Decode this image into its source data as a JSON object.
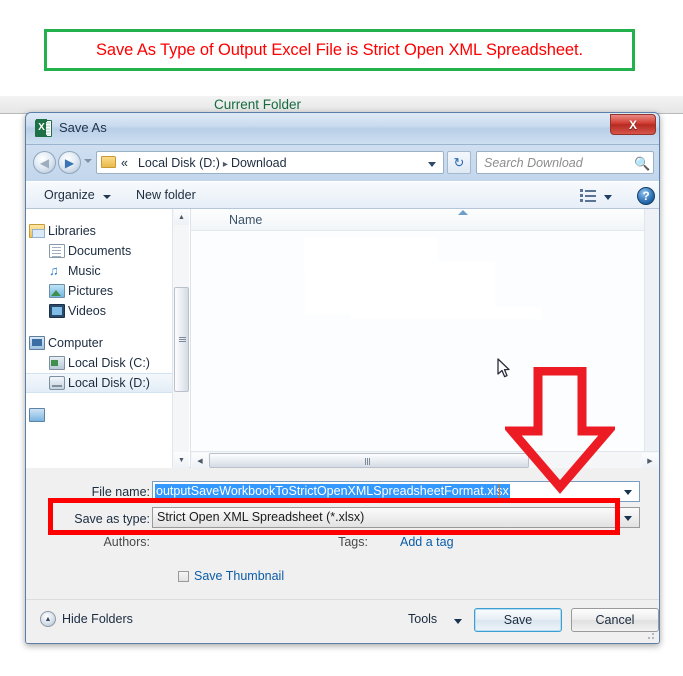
{
  "caption": {
    "text": "Save As Type of Output Excel File is Strict Open XML Spreadsheet.",
    "text_color": "#ff0000",
    "border_color": "#22b14c"
  },
  "background": {
    "label": "Current Folder",
    "label_color": "#156b3f"
  },
  "dialog": {
    "title": "Save As",
    "app_icon": "excel-icon",
    "close_label": "X",
    "address": {
      "back_icon": "back-arrow-icon",
      "forward_icon": "forward-arrow-icon",
      "recent_icon": "recent-pages-chevron-icon",
      "folder_icon": "folder-icon",
      "breadcrumb_prefix": "«",
      "breadcrumb": [
        "Local Disk (D:)",
        "Download"
      ],
      "breadcrumb_separator": "▸",
      "dropdown_icon": "chevron-down-icon",
      "refresh_icon": "↻",
      "search_placeholder": "Search Download",
      "search_icon": "search-icon"
    },
    "commandbar": {
      "organize": "Organize",
      "new_folder": "New folder",
      "view_icon": "view-layout-icon",
      "help_icon": "help-icon",
      "help_label": "?"
    },
    "navigation": {
      "groups": [
        {
          "label": "Libraries",
          "icon": "libraries-icon",
          "children": [
            {
              "label": "Documents",
              "icon": "documents-icon"
            },
            {
              "label": "Music",
              "icon": "music-icon"
            },
            {
              "label": "Pictures",
              "icon": "pictures-icon"
            },
            {
              "label": "Videos",
              "icon": "videos-icon"
            }
          ]
        },
        {
          "label": "Computer",
          "icon": "computer-icon",
          "children": [
            {
              "label": "Local Disk (C:)",
              "icon": "hard-disk-icon"
            },
            {
              "label": "Local Disk (D:)",
              "icon": "hard-disk-icon",
              "selected": true
            }
          ]
        }
      ]
    },
    "filelist": {
      "column_header": "Name",
      "sort_icon": "sort-ascending-icon",
      "items": []
    },
    "form": {
      "filename_label": "File name:",
      "filename_value": "outputSaveWorkbookToStrictOpenXMLSpreadsheetFormat.xlsx",
      "savetype_label": "Save as type:",
      "savetype_value": "Strict Open XML Spreadsheet (*.xlsx)",
      "authors_label": "Authors:",
      "authors_value": "",
      "tags_label": "Tags:",
      "tags_link": "Add a tag",
      "thumbnail_label": "Save Thumbnail",
      "thumbnail_checked": false
    },
    "footer": {
      "hide_folders": "Hide Folders",
      "hide_folders_icon": "collapse-icon",
      "tools": "Tools",
      "save": "Save",
      "cancel": "Cancel"
    }
  },
  "annotations": {
    "highlight_color": "#ff0000",
    "arrow_icon": "down-arrow-annotation",
    "cursor_icon": "mouse-pointer-icon"
  }
}
